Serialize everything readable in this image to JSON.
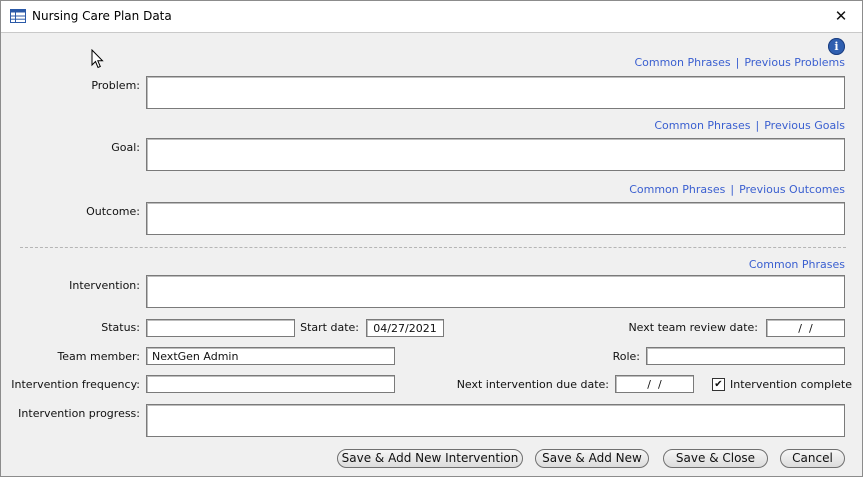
{
  "window": {
    "title": "Nursing Care Plan Data",
    "close_glyph": "✕"
  },
  "icons": {
    "app": "table-icon",
    "info": "info-icon",
    "info_glyph": "i"
  },
  "problem": {
    "label": "Problem:",
    "links": {
      "common": "Common Phrases",
      "sep": "|",
      "previous": "Previous Problems"
    },
    "value": ""
  },
  "goal": {
    "label": "Goal:",
    "links": {
      "common": "Common Phrases",
      "sep": "|",
      "previous": "Previous Goals"
    },
    "value": ""
  },
  "outcome": {
    "label": "Outcome:",
    "links": {
      "common": "Common Phrases",
      "sep": "|",
      "previous": "Previous Outcomes"
    },
    "value": ""
  },
  "intervention": {
    "label": "Intervention:",
    "links": {
      "common": "Common Phrases"
    },
    "value": ""
  },
  "status": {
    "label": "Status:",
    "value": ""
  },
  "start_date": {
    "label": "Start date:",
    "value": "04/27/2021"
  },
  "next_team_review_date": {
    "label": "Next team review date:",
    "value": " /  / "
  },
  "team_member": {
    "label": "Team member:",
    "value": "NextGen Admin"
  },
  "role": {
    "label": "Role:",
    "value": ""
  },
  "intervention_frequency": {
    "label": "Intervention frequency:",
    "value": ""
  },
  "next_intervention_due_date": {
    "label": "Next intervention due date:",
    "value": " /  / "
  },
  "intervention_complete": {
    "label": "Intervention complete",
    "checked": true,
    "check_glyph": "✔"
  },
  "intervention_progress": {
    "label": "Intervention progress:",
    "value": ""
  },
  "buttons": {
    "save_add_intervention": "Save & Add New Intervention",
    "save_add_new": "Save & Add New",
    "save_close": "Save & Close",
    "cancel": "Cancel"
  },
  "colors": {
    "link": "#3a5fd0",
    "info": "#2f5fb0",
    "background": "#f0f0f0"
  }
}
